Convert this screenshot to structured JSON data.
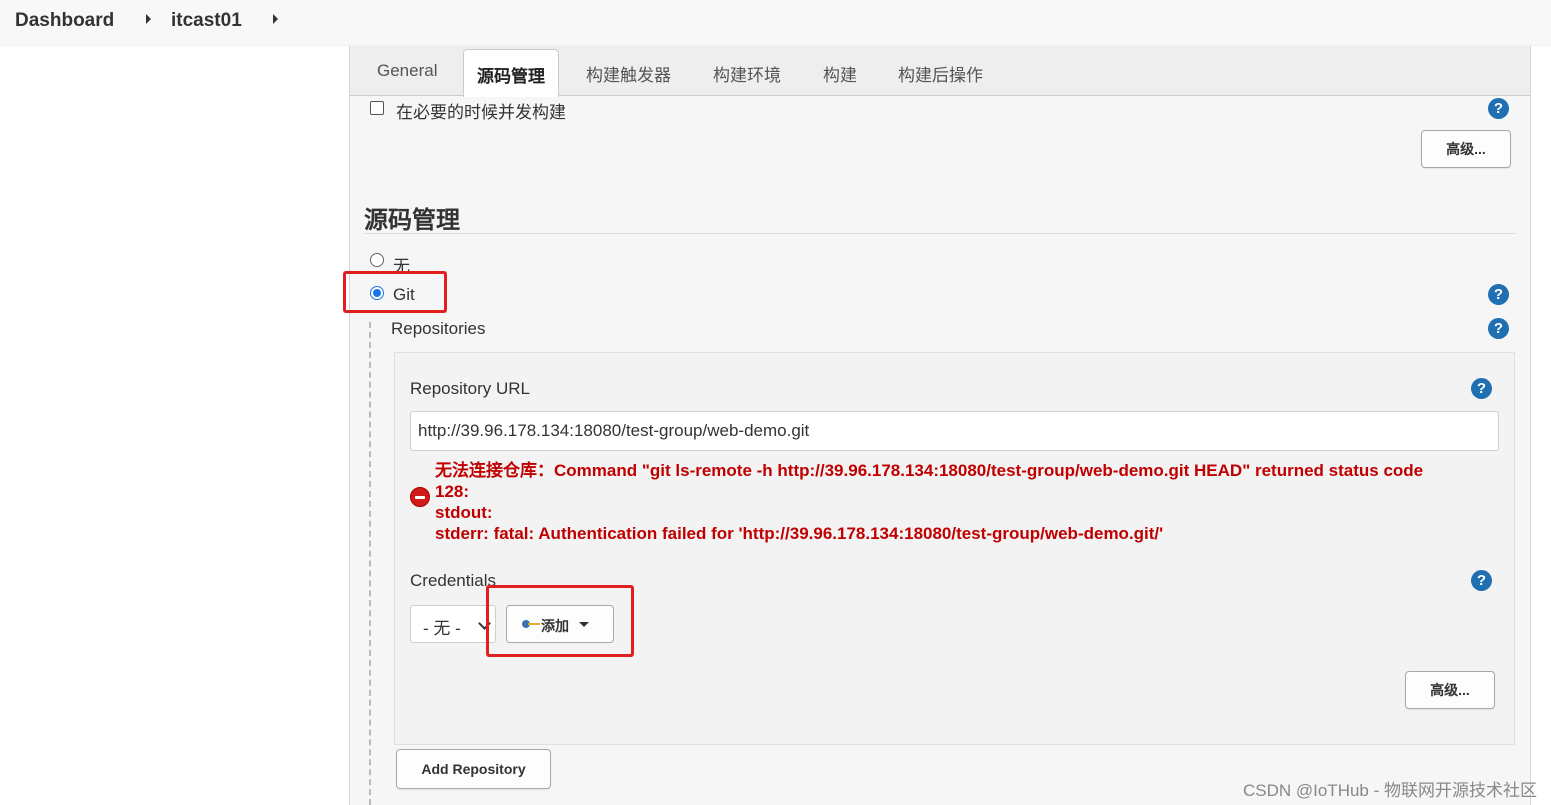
{
  "breadcrumb": {
    "items": [
      "Dashboard",
      "itcast01"
    ]
  },
  "tabs": [
    "General",
    "源码管理",
    "构建触发器",
    "构建环境",
    "构建",
    "构建后操作"
  ],
  "active_tab": "源码管理",
  "concurrent_build": {
    "label": "在必要的时候并发构建",
    "checked": false
  },
  "advanced_label": "高级...",
  "section": {
    "title": "源码管理"
  },
  "scm_options": [
    {
      "label": "无",
      "checked": false
    },
    {
      "label": "Git",
      "checked": true
    }
  ],
  "repositories": {
    "label": "Repositories",
    "url_label": "Repository URL",
    "url_value": "http://39.96.178.134:18080/test-group/web-demo.git",
    "error_lines": [
      "无法连接仓库：Command \"git ls-remote -h http://39.96.178.134:18080/test-group/web-demo.git HEAD\" returned status code",
      "128:",
      "stdout:",
      "stderr: fatal: Authentication failed for 'http://39.96.178.134:18080/test-group/web-demo.git/'"
    ],
    "credentials_label": "Credentials",
    "credentials_value": "- 无 -",
    "add_label": "添加",
    "advanced_label": "高级..."
  },
  "add_repository_label": "Add Repository",
  "help_symbol": "?",
  "watermark": "CSDN @IoTHub - 物联网开源技术社区",
  "colors": {
    "accent": "#1f6fb2",
    "error": "#c00000",
    "highlight": "#e02020"
  },
  "icons": [
    "caret-right-icon",
    "help-icon",
    "error-icon",
    "key-icon",
    "chevron-down-icon",
    "caret-down-icon"
  ]
}
